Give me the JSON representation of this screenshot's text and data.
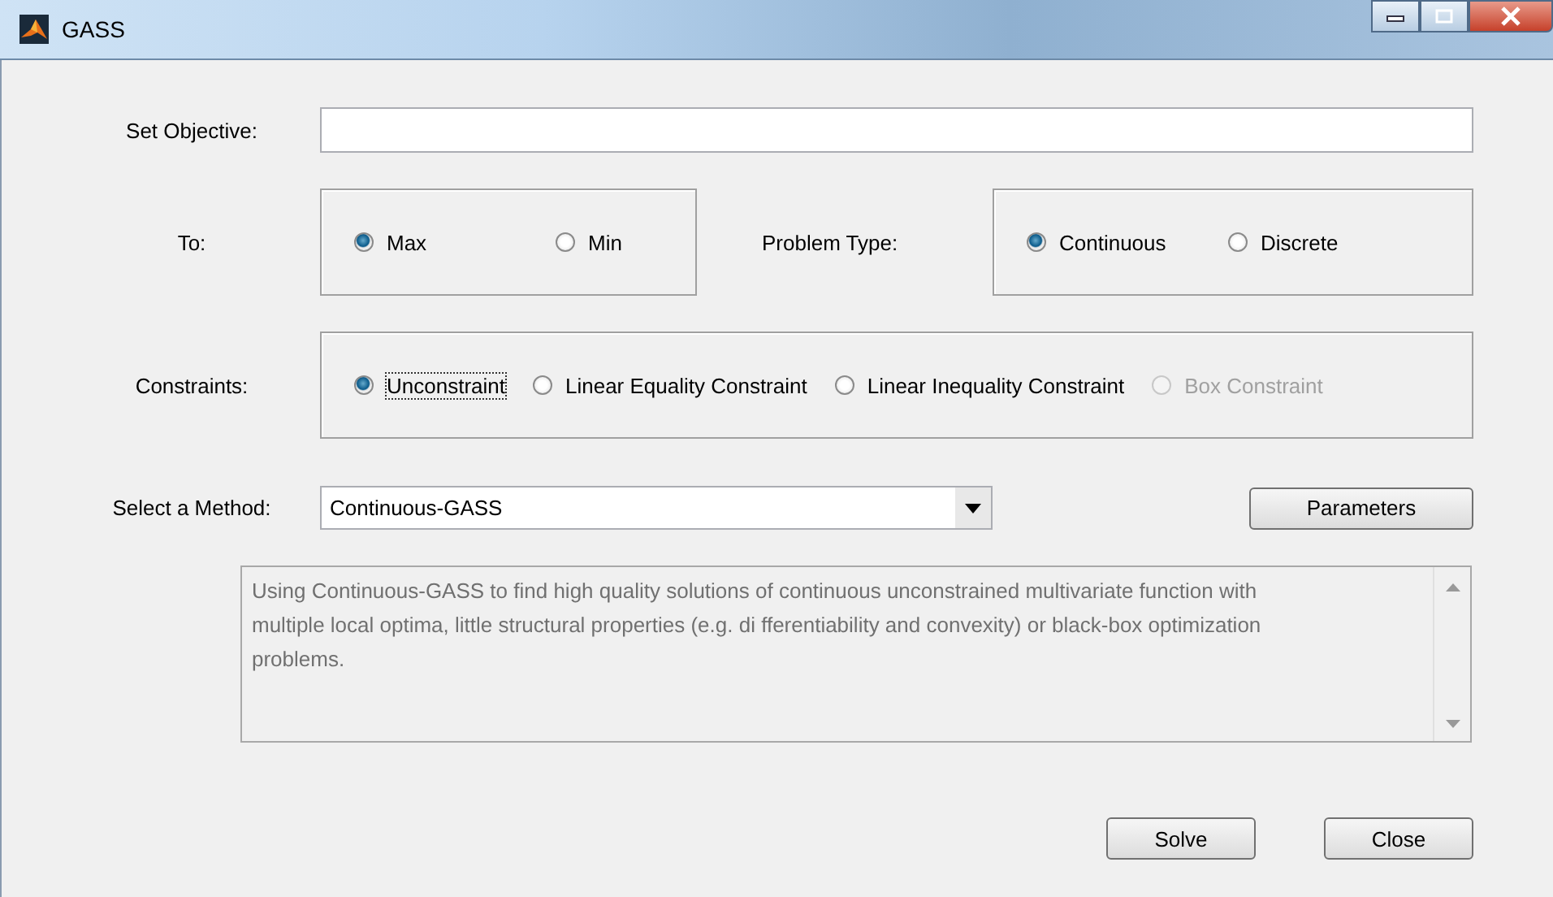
{
  "window": {
    "title": "GASS"
  },
  "objective": {
    "label": "Set Objective:"
  },
  "to": {
    "label": "To:",
    "options": [
      {
        "label": "Max",
        "selected": true
      },
      {
        "label": "Min",
        "selected": false
      }
    ]
  },
  "problem_type": {
    "label": "Problem Type:",
    "options": [
      {
        "label": "Continuous",
        "selected": true
      },
      {
        "label": "Discrete",
        "selected": false
      }
    ]
  },
  "constraints": {
    "label": "Constraints:",
    "options": [
      {
        "label": "Unconstraint",
        "selected": true,
        "focused": true,
        "disabled": false
      },
      {
        "label": "Linear Equality Constraint",
        "selected": false,
        "focused": false,
        "disabled": false
      },
      {
        "label": "Linear Inequality Constraint",
        "selected": false,
        "focused": false,
        "disabled": false
      },
      {
        "label": "Box Constraint",
        "selected": false,
        "focused": false,
        "disabled": true
      }
    ]
  },
  "method": {
    "label": "Select a Method:",
    "value": "Continuous-GASS"
  },
  "parameters_button": "Parameters",
  "description": "Using Continuous-GASS to find high quality solutions of continuous unconstrained multivariate function with multiple local optima, little structural properties (e.g. di fferentiability and convexity) or black-box optimization problems.",
  "buttons": [
    "Solve",
    "Close"
  ]
}
